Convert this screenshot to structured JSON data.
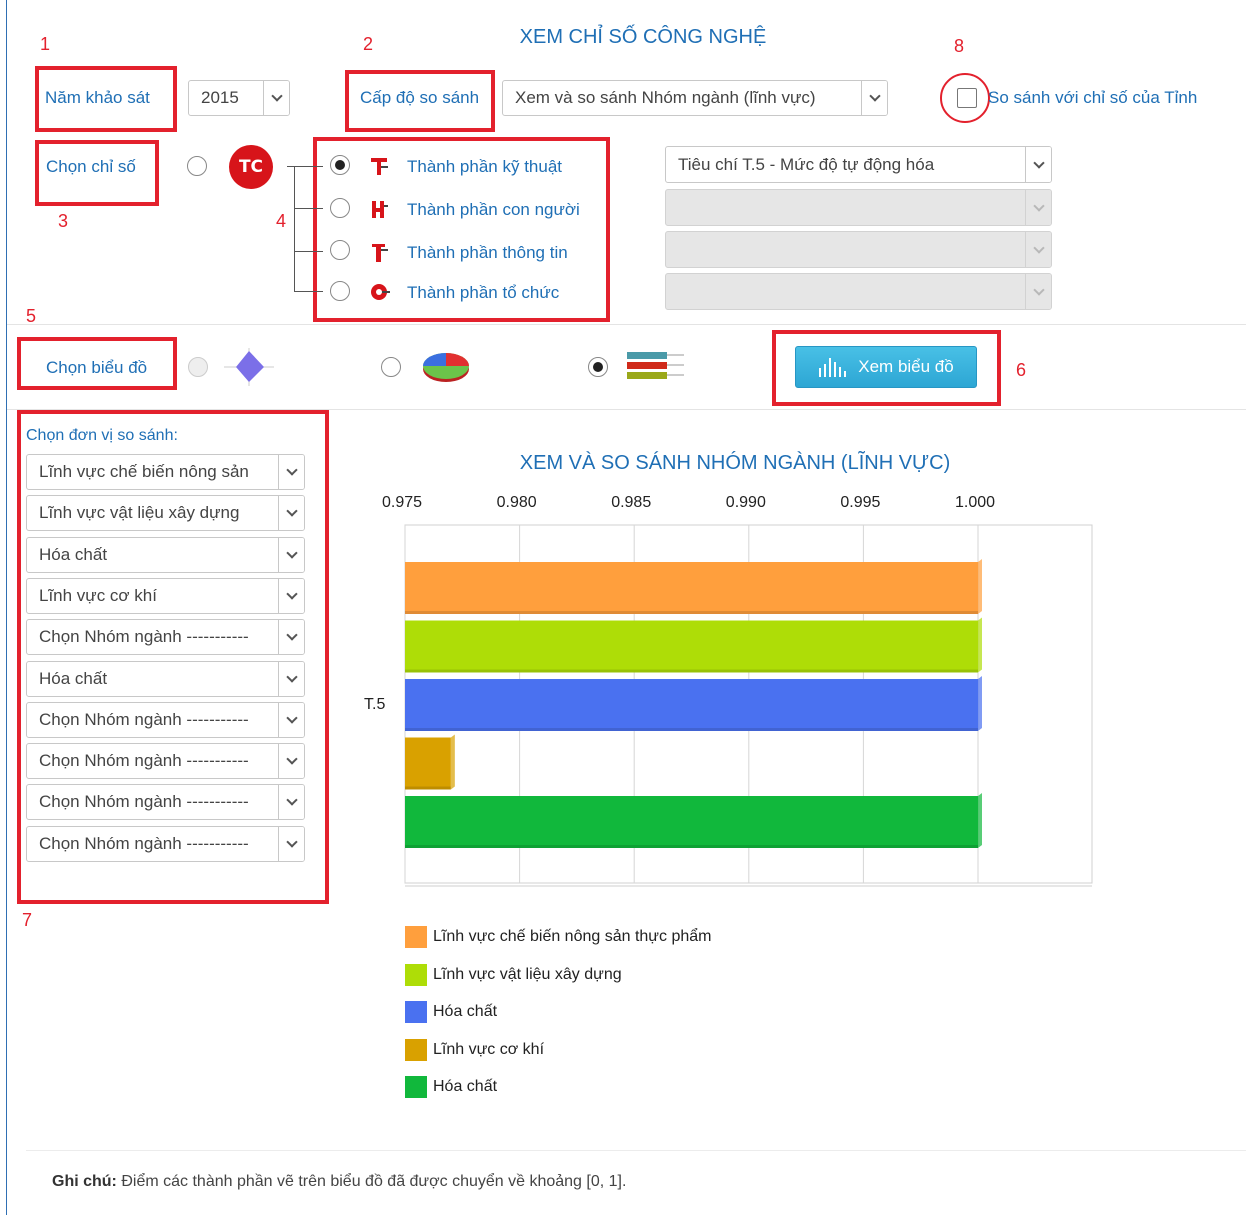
{
  "page_title": "XEM CHỈ SỐ CÔNG NGHỆ",
  "survey_year": {
    "label": "Năm khảo sát",
    "value": "2015"
  },
  "comparison_level": {
    "label": "Cấp độ so sánh",
    "value": "Xem và so sánh Nhóm ngành (lĩnh vực)"
  },
  "compare_province": {
    "label": "So sánh với chỉ số của Tỉnh",
    "checked": false
  },
  "index_select": {
    "label": "Chọn chỉ số",
    "logo_text": "TC",
    "components": [
      {
        "label": "Thành phần kỹ thuật",
        "glyph": "T",
        "checked": true,
        "criteria": "Tiêu chí T.5 - Mức độ tự động hóa"
      },
      {
        "label": "Thành phần con người",
        "glyph": "H",
        "checked": false,
        "criteria": ""
      },
      {
        "label": "Thành phần thông tin",
        "glyph": "I",
        "checked": false,
        "criteria": ""
      },
      {
        "label": "Thành phần tổ chức",
        "glyph": "O",
        "checked": false,
        "criteria": ""
      }
    ]
  },
  "chart_type": {
    "label": "Chọn biểu đồ",
    "options": [
      {
        "name": "radar-chart-icon",
        "checked": false,
        "disabled": true
      },
      {
        "name": "pie-chart-icon",
        "checked": false,
        "disabled": false
      },
      {
        "name": "bar-chart-icon",
        "checked": true,
        "disabled": false
      }
    ],
    "view_button": "Xem biểu đồ"
  },
  "compare_units": {
    "label": "Chọn đơn vị so sánh:",
    "selects": [
      "Lĩnh vực chế biến nông sản",
      "Lĩnh vực vật liệu xây dựng",
      "Hóa chất",
      "Lĩnh vực cơ khí",
      "Chọn Nhóm ngành -----------",
      "Hóa chất",
      "Chọn Nhóm ngành -----------",
      "Chọn Nhóm ngành -----------",
      "Chọn Nhóm ngành -----------",
      "Chọn Nhóm ngành -----------"
    ]
  },
  "annotations": [
    "1",
    "2",
    "3",
    "4",
    "5",
    "6",
    "7",
    "8"
  ],
  "colors": {
    "accent_blue": "#1f6fb5",
    "annotation_red": "#e3212d",
    "button": "#3bb3df"
  },
  "chart_data": {
    "type": "bar",
    "orientation": "horizontal",
    "title": "XEM VÀ SO SÁNH NHÓM NGÀNH (LĨNH VỰC)",
    "categories": [
      "T.5"
    ],
    "xlim": [
      0.975,
      1.0
    ],
    "x_ticks": [
      "0.975",
      "0.980",
      "0.985",
      "0.990",
      "0.995",
      "1.000"
    ],
    "grid": true,
    "legend_position": "bottom",
    "series": [
      {
        "name": "Lĩnh vực chế biến nông sản thực phẩm",
        "values": [
          1.0
        ],
        "color": "#ff9f3d"
      },
      {
        "name": "Lĩnh vực vật liệu xây dựng",
        "values": [
          1.0
        ],
        "color": "#aedd07"
      },
      {
        "name": "Hóa chất",
        "values": [
          1.0
        ],
        "color": "#4a71f0"
      },
      {
        "name": "Lĩnh vực cơ khí",
        "values": [
          0.977
        ],
        "color": "#d9a100"
      },
      {
        "name": "Hóa chất",
        "values": [
          1.0
        ],
        "color": "#11b83c"
      }
    ]
  },
  "note": {
    "prefix": "Ghi chú:",
    "text": "Điểm các thành phần vẽ trên biểu đồ đã được chuyển về khoảng [0, 1]."
  }
}
